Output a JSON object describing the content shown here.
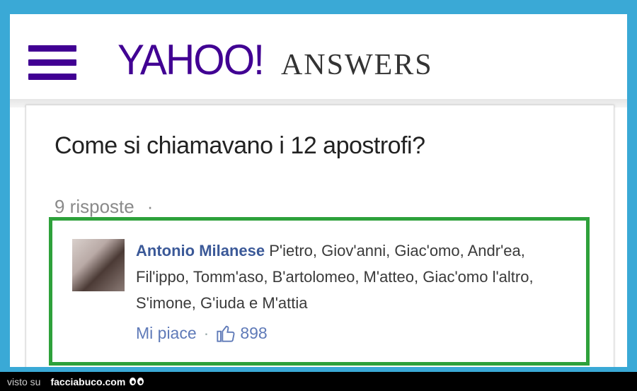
{
  "header": {
    "logo_text": "YAHOO!",
    "logo_suffix": "ANSWERS",
    "menu_icon": "hamburger-menu-icon",
    "brand_color": "#410093"
  },
  "question": {
    "title": "Come si chiamavano i 12 apostrofi?",
    "answers_count": "9 risposte",
    "answers_separator": "·"
  },
  "answer": {
    "author": "Antonio Milanese",
    "text": " P'ietro, Giov'anni, Giac'omo, Andr'ea, Fil'ippo, Tomm'aso, B'artolomeo, M'atteo, Giac'omo l'altro, S'imone, G'iuda e M'attia",
    "like_label": "Mi piace",
    "separator": "·",
    "like_count": "898",
    "like_icon": "thumbs-up-icon",
    "highlight_color": "#2ea13b"
  },
  "footer": {
    "visto_su": "visto su",
    "site": "facciabuco.com"
  }
}
